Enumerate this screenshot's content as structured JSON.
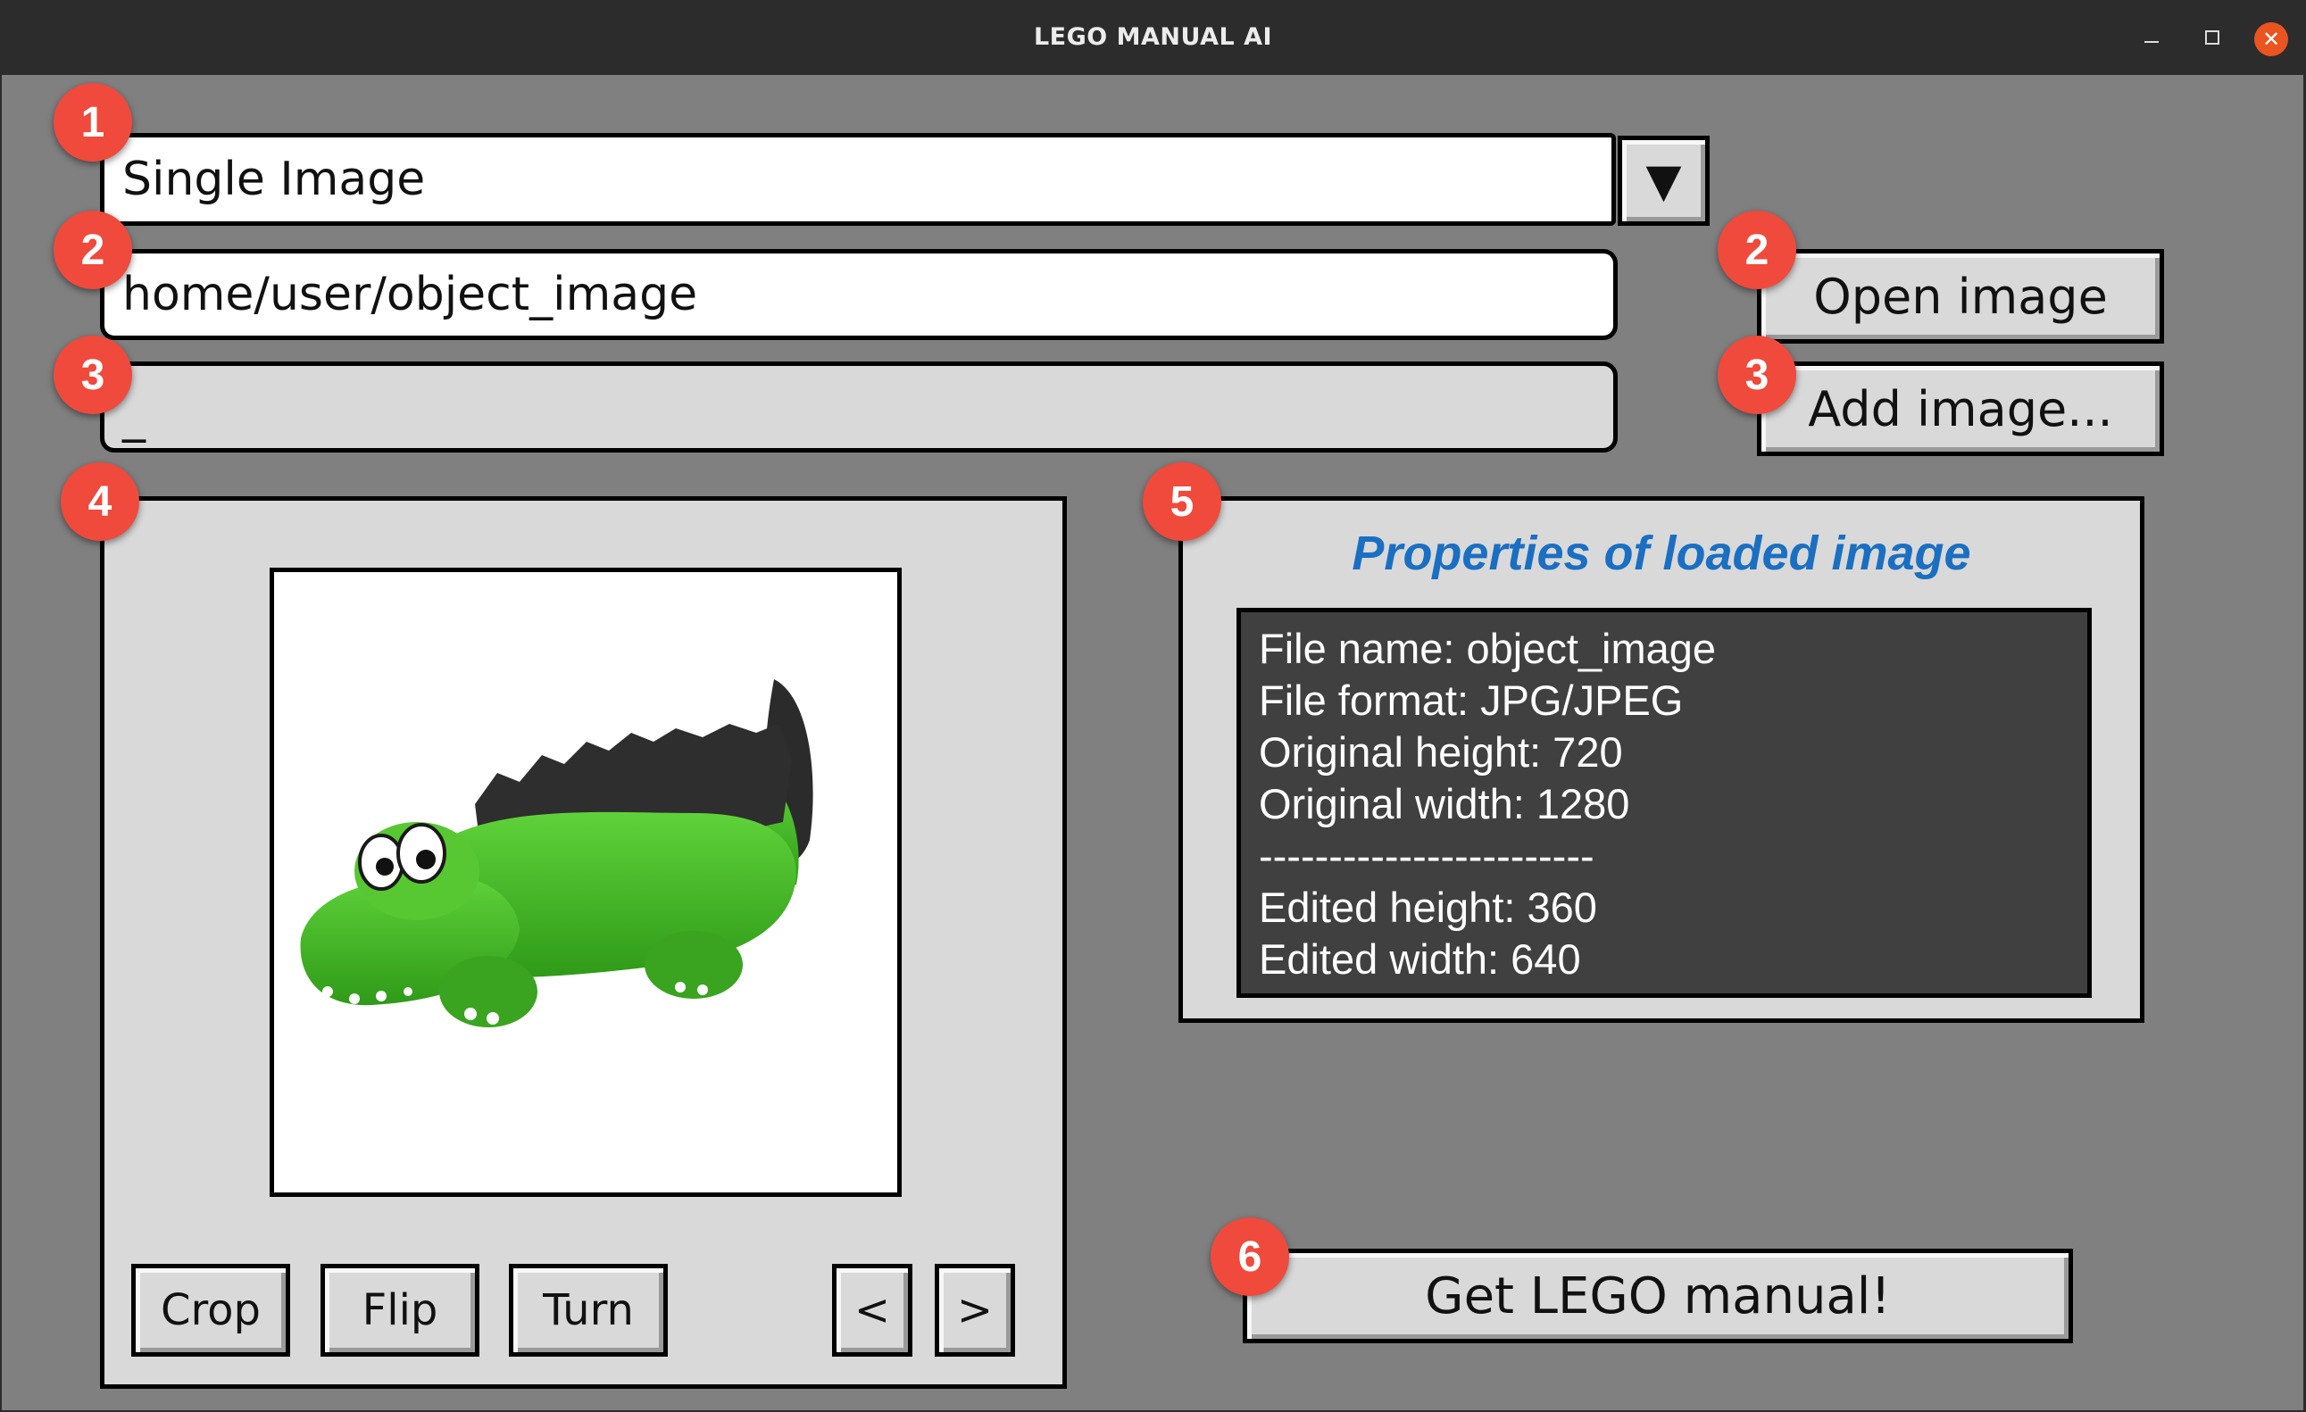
{
  "window": {
    "title": "LEGO MANUAL AI",
    "controls": {
      "close_glyph": "✕"
    }
  },
  "mode_select": {
    "value": "Single Image",
    "arrow_glyph": "▼"
  },
  "path_field": {
    "value": "home/user/object_image"
  },
  "add_field": {
    "value": "_"
  },
  "buttons": {
    "open_image": "Open image",
    "add_image": "Add image...",
    "crop": "Crop",
    "flip": "Flip",
    "turn": "Turn",
    "prev": "<",
    "next": ">",
    "get_manual": "Get LEGO manual!"
  },
  "badges": {
    "mode": "1",
    "path": "2",
    "open": "2",
    "add_field": "3",
    "add_button": "3",
    "preview": "4",
    "properties": "5",
    "get_manual": "6"
  },
  "properties": {
    "title": "Properties of loaded image",
    "lines": [
      "File name: object_image",
      "File format: JPG/JPEG",
      "Original height: 720",
      "Original width: 1280",
      "------------------------",
      "Edited height: 360",
      "Edited width: 640"
    ]
  },
  "colors": {
    "window_bg": "#808080",
    "badge": "#f04a3c",
    "title_accent": "#1a6fc2",
    "props_bg": "#404040",
    "close_button": "#e95420"
  }
}
